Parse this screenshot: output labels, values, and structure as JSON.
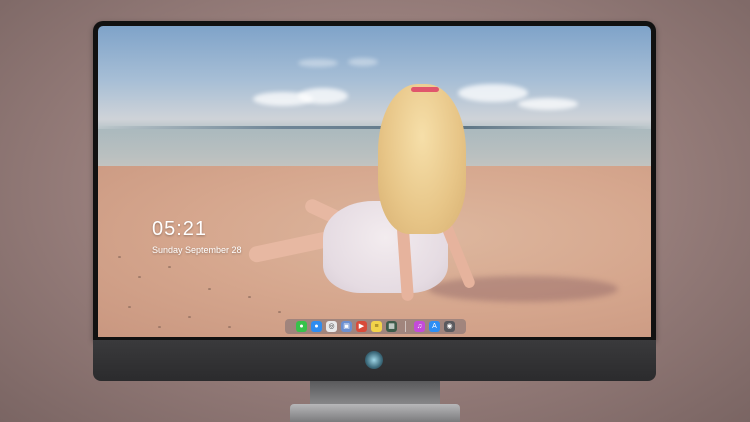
{
  "lockscreen": {
    "time": "05:21",
    "date": "Sunday September 28"
  },
  "dock": {
    "items": [
      {
        "name": "messages",
        "color": "#37c24a",
        "glyph": "✉"
      },
      {
        "name": "mail",
        "color": "#2f8cf0",
        "glyph": "✉"
      },
      {
        "name": "safari",
        "color": "#e8e8ea",
        "glyph": "◎"
      },
      {
        "name": "files",
        "color": "#6c8fd0",
        "glyph": "▣"
      },
      {
        "name": "video",
        "color": "#d84a3a",
        "glyph": "▶"
      },
      {
        "name": "notes",
        "color": "#f3d34a",
        "glyph": "≡"
      },
      {
        "name": "terminal",
        "color": "#3e5c4a",
        "glyph": "▦"
      },
      {
        "name": "music",
        "color": "#c44bd9",
        "glyph": "♫"
      },
      {
        "name": "app-store",
        "color": "#2c8ef5",
        "glyph": "A"
      },
      {
        "name": "camera",
        "color": "#5a5a5e",
        "glyph": "◉"
      }
    ]
  },
  "colors": {
    "bezel": "#111111",
    "chin": "#333335"
  }
}
